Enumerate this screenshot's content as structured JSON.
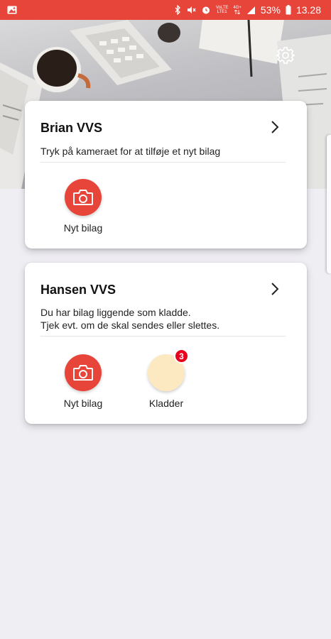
{
  "status_bar": {
    "battery_percent": "53%",
    "time": "13.28",
    "network_top": "VoLTE",
    "network_signal": "4G+",
    "network_lte": "LTE1",
    "icons": [
      "image-icon",
      "bluetooth-icon",
      "mute-icon",
      "alarm-icon",
      "wifi-icon",
      "signal-icon",
      "battery-icon"
    ]
  },
  "header": {
    "settings_icon": "gear-icon"
  },
  "cards": [
    {
      "title": "Brian VVS",
      "description": "Tryk på kameraet for at tilføje et nyt bilag",
      "actions": [
        {
          "label": "Nyt bilag",
          "icon": "camera-icon"
        }
      ]
    },
    {
      "title": "Hansen VVS",
      "description_line1": "Du har bilag liggende som kladde.",
      "description_line2": "Tjek evt. om de skal sendes eller slettes.",
      "actions": [
        {
          "label": "Nyt bilag",
          "icon": "camera-icon"
        },
        {
          "label": "Kladder",
          "badge": "3"
        }
      ]
    }
  ],
  "colors": {
    "accent": "#e8453a",
    "background": "#efeef3",
    "draft_circle": "#fde9c1",
    "badge": "#e8001f"
  }
}
